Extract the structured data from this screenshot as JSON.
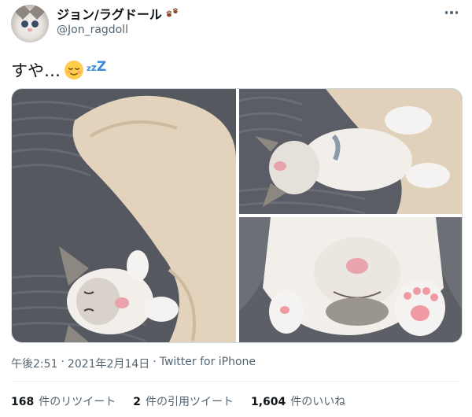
{
  "user": {
    "display_name": "ジョン/ラグドール",
    "handle": "@Jon_ragdoll",
    "name_badge_icon": "paw-prints-icon",
    "avatar_icon": "cat-face-avatar"
  },
  "menu": {
    "icon": "more-horizontal-icon"
  },
  "tweet": {
    "text": "すや…",
    "emoji": "relieved-face-emoji",
    "zzz": [
      "z",
      "z",
      "Z"
    ]
  },
  "media": [
    {
      "subject": "sleeping-cat-photo-1"
    },
    {
      "subject": "sleeping-cat-photo-2"
    },
    {
      "subject": "sleeping-cat-photo-3"
    }
  ],
  "meta": {
    "time": "午後2:51",
    "sep1": "·",
    "date": "2021年2月14日",
    "sep2": "·",
    "source": "Twitter for iPhone"
  },
  "stats": {
    "retweets": {
      "count": "168",
      "label": "件のリツイート"
    },
    "quotes": {
      "count": "2",
      "label": "件の引用ツイート"
    },
    "likes": {
      "count": "1,604",
      "label": "件のいいね"
    }
  },
  "colors": {
    "text": "#0f1419",
    "secondary": "#536471",
    "zzz": "#3d8bd9",
    "blanket": "#e3d3bd",
    "fabric": "#5e6169",
    "paw_pad": "#f09aa3"
  }
}
